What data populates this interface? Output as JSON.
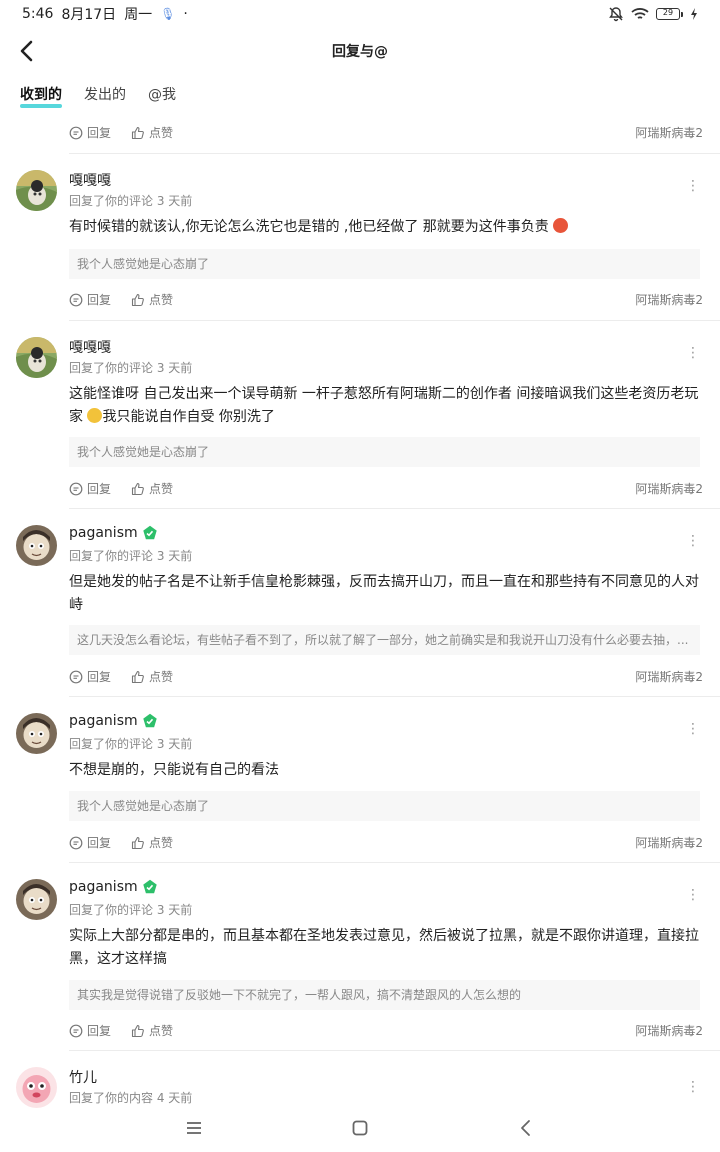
{
  "status_bar": {
    "time": "5:46",
    "date": "8月17日",
    "weekday": "周一",
    "dot": "·",
    "battery": "29"
  },
  "header": {
    "title": "回复与@"
  },
  "tabs": [
    {
      "label": "收到的"
    },
    {
      "label": "发出的"
    },
    {
      "label": "@我"
    }
  ],
  "actions": {
    "reply": "回复",
    "like": "点赞"
  },
  "comments": [
    {
      "game": "阿瑞斯病毒2"
    },
    {
      "username": "嘎嘎嘎",
      "meta": "回复了你的评论 3 天前",
      "text": "有时候错的就该认,你无论怎么洗它也是错的 ,他已经做了 那就要为这件事负责",
      "quote": "我个人感觉她是心态崩了",
      "game": "阿瑞斯病毒2",
      "more": "⋮"
    },
    {
      "username": "嘎嘎嘎",
      "meta": "回复了你的评论 3 天前",
      "text_a": "这能怪谁呀 自己发出来一个误导萌新 一杆子惹怒所有阿瑞斯二的创作者 间接暗讽我们这些老资历老玩家",
      "text_b": "我只能说自作自受 你别洗了",
      "quote": "我个人感觉她是心态崩了",
      "game": "阿瑞斯病毒2",
      "more": "⋮"
    },
    {
      "username": "paganism",
      "meta": "回复了你的评论 3 天前",
      "text": "但是她发的帖子名是不让新手信皇枪影棘强，反而去搞开山刀，而且一直在和那些持有不同意见的人对峙",
      "quote": "这几天没怎么看论坛，有些帖子看不到了，所以就了解了一部分，她之前确实是和我说开山刀没有什么必要去抽，...",
      "game": "阿瑞斯病毒2",
      "more": "⋮"
    },
    {
      "username": "paganism",
      "meta": "回复了你的评论 3 天前",
      "text": "不想是崩的，只能说有自己的看法",
      "quote": "我个人感觉她是心态崩了",
      "game": "阿瑞斯病毒2",
      "more": "⋮"
    },
    {
      "username": "paganism",
      "meta": "回复了你的评论 3 天前",
      "text": "实际上大部分都是串的，而且基本都在圣地发表过意见，然后被说了拉黑，就是不跟你讲道理，直接拉黑，这才这样搞",
      "quote": "其实我是觉得说错了反驳她一下不就完了，一帮人跟风，搞不清楚跟风的人怎么想的",
      "game": "阿瑞斯病毒2",
      "more": "⋮"
    },
    {
      "username": "竹儿",
      "meta": "回复了你的内容 4 天前",
      "more": "⋮"
    }
  ],
  "colors": {
    "accent": "#3ad0d6",
    "badge": "#2dbf6a",
    "battery": "#4cc05a"
  }
}
